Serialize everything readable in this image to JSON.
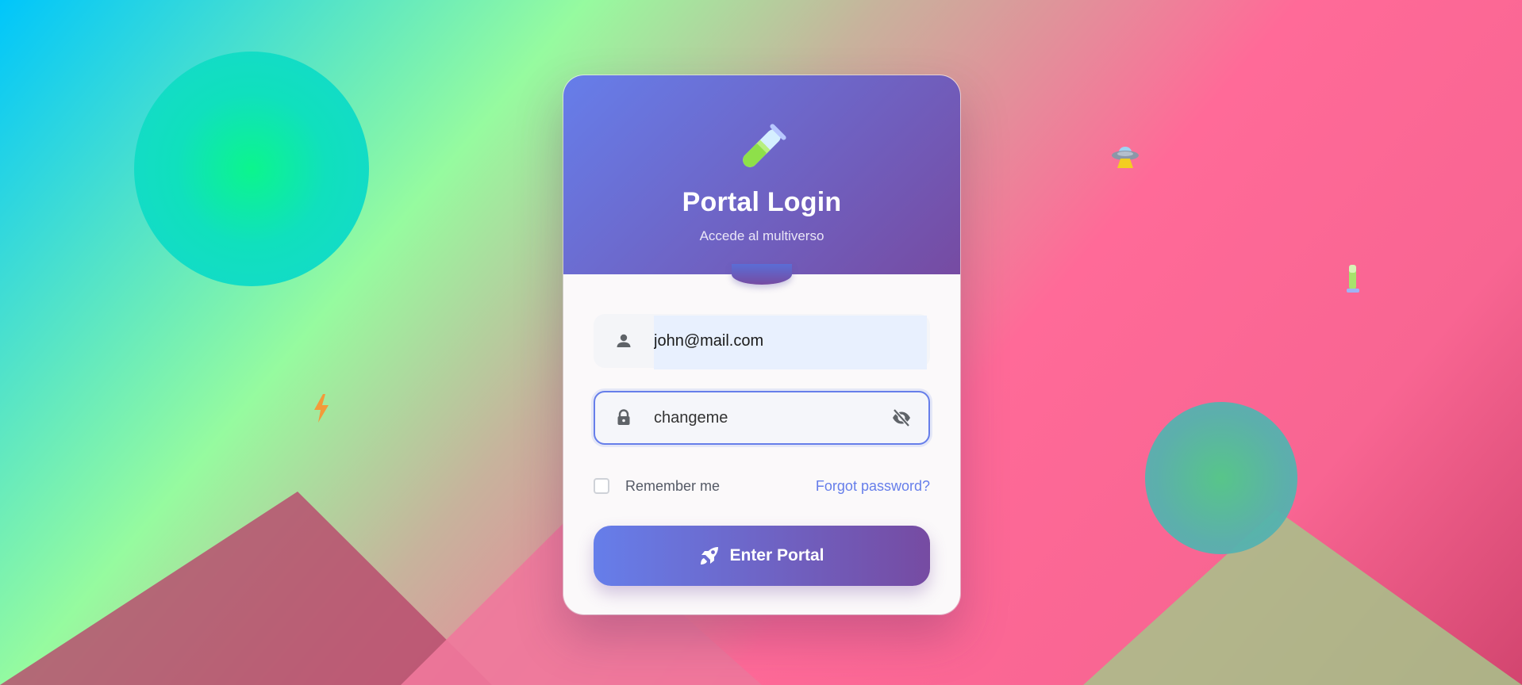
{
  "header": {
    "icon": "test-tube-icon",
    "title": "Portal Login",
    "subtitle": "Accede al multiverso"
  },
  "form": {
    "email": {
      "icon": "user-icon",
      "value": "john@mail.com"
    },
    "password": {
      "icon": "lock-icon",
      "value": "changeme",
      "toggle_icon": "eye-slash-icon"
    },
    "remember_label": "Remember me",
    "remember_checked": false,
    "forgot_label": "Forgot password?",
    "submit": {
      "icon": "rocket-icon",
      "label": "Enter Portal"
    }
  },
  "decorations": [
    "ufo-icon",
    "test-tube-icon",
    "lightning-icon"
  ],
  "colors": {
    "accent_start": "#667eea",
    "accent_end": "#764ba2",
    "link": "#667eea"
  }
}
